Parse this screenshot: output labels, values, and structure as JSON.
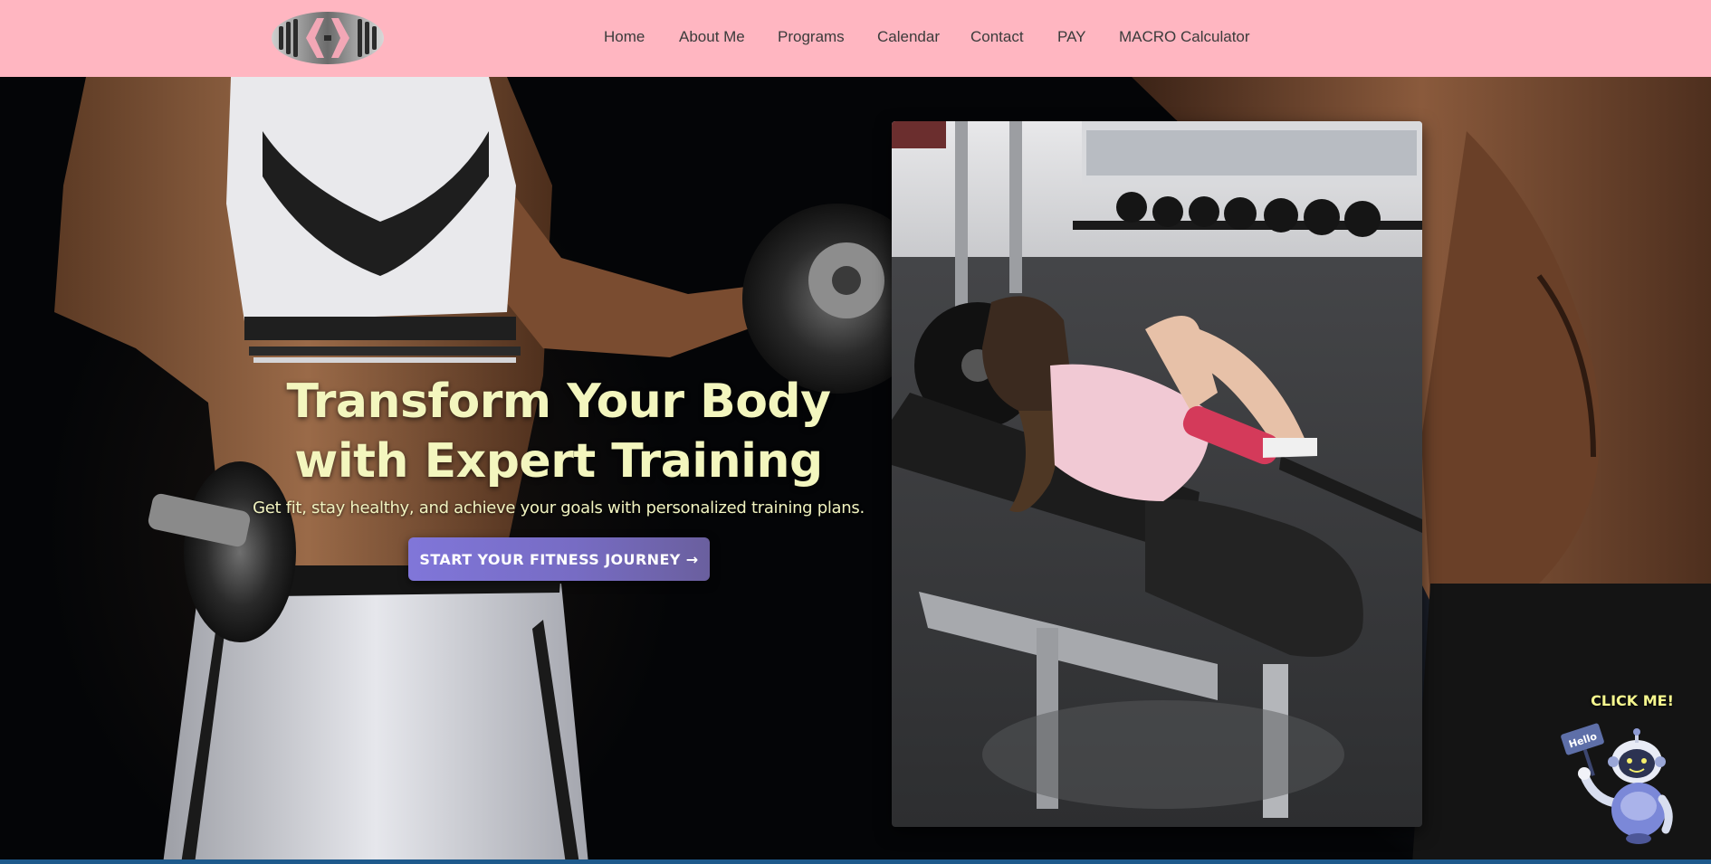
{
  "nav": {
    "logo_alt": "logo",
    "links": [
      {
        "label": "Home"
      },
      {
        "label": "About Me"
      },
      {
        "label": "Programs"
      },
      {
        "label": "Calendar"
      },
      {
        "label": "Contact"
      },
      {
        "label": "PAY"
      },
      {
        "label": "MACRO Calculator"
      }
    ]
  },
  "hero": {
    "headline_line1": "Transform Your Body",
    "headline_line2": "with Expert Training",
    "subtitle": "Get fit, stay healthy, and achieve your goals with personalized training plans.",
    "cta_label": "START YOUR FITNESS JOURNEY →"
  },
  "chatbot": {
    "label": "CLICK ME!",
    "sign_text": "Hello"
  },
  "colors": {
    "header_bg": "#ffb6c1",
    "headline": "#f3f6be",
    "cta_start": "#8076d9",
    "cta_end": "#6a5f9e",
    "bot_label": "#f5f68e"
  }
}
